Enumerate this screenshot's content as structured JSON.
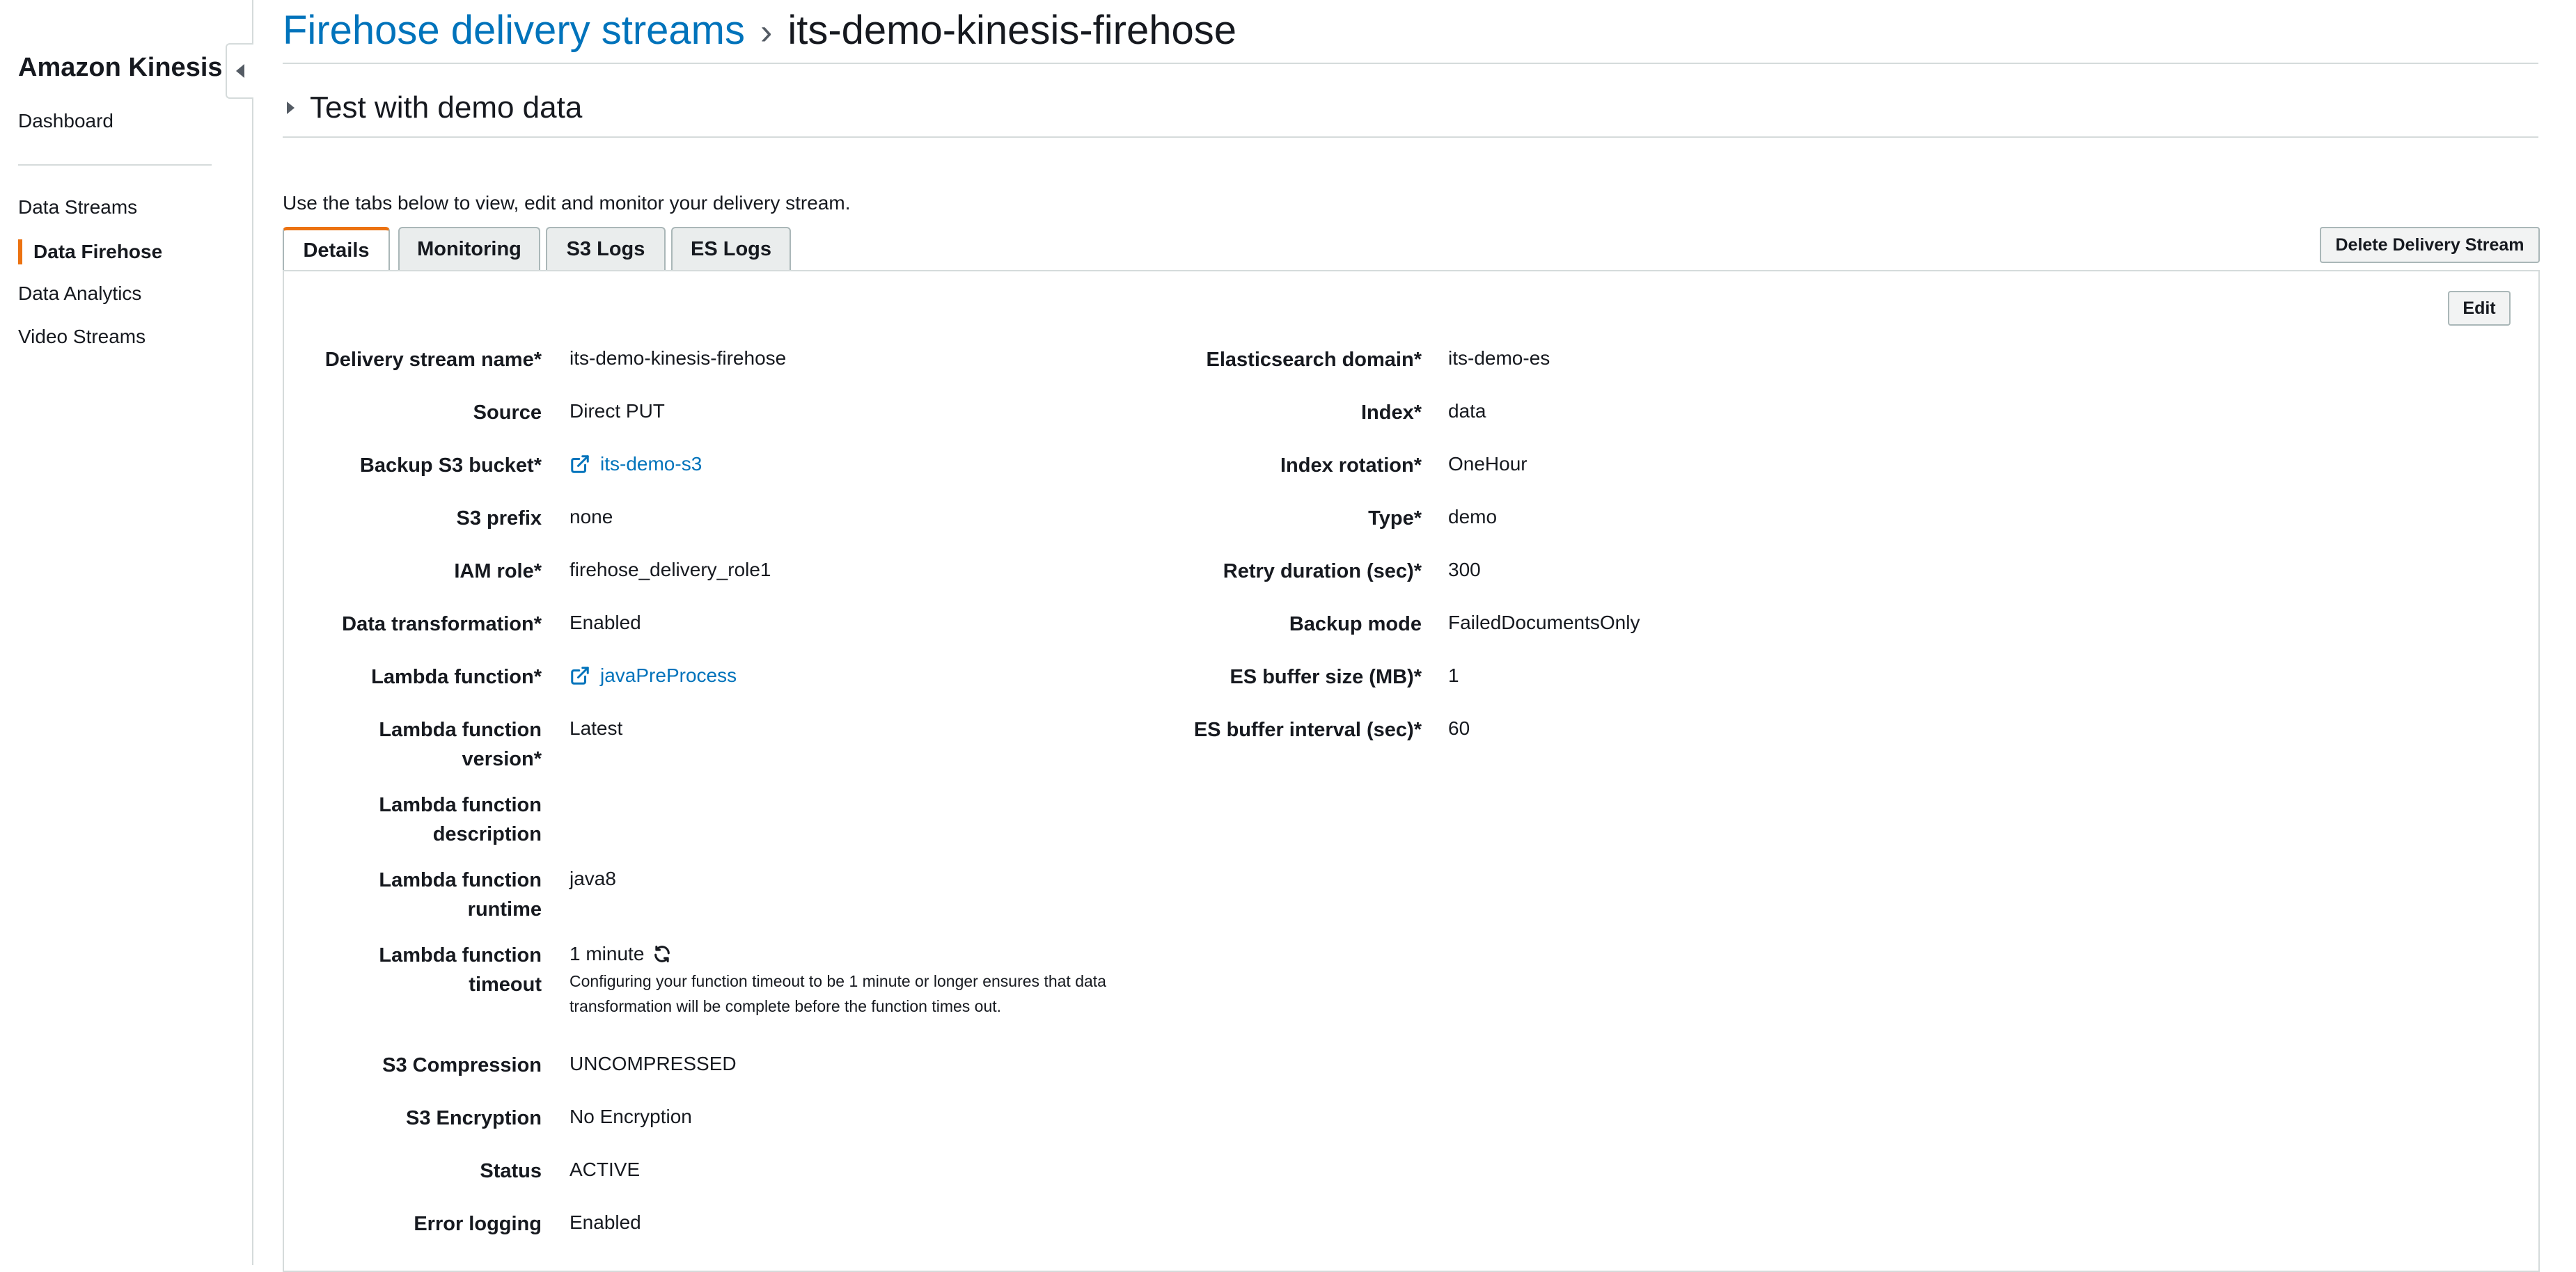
{
  "sidebar": {
    "brand": "Amazon Kinesis",
    "dashboard": "Dashboard",
    "items": [
      {
        "label": "Data Streams"
      },
      {
        "label": "Data Firehose",
        "active": true
      },
      {
        "label": "Data Analytics"
      },
      {
        "label": "Video Streams"
      }
    ]
  },
  "breadcrumb": {
    "parent": "Firehose delivery streams",
    "current": "its-demo-kinesis-firehose"
  },
  "test_section": "Test with demo data",
  "intro": "Use the tabs below to view, edit and monitor your delivery stream.",
  "tabs": [
    {
      "label": "Details",
      "active": true
    },
    {
      "label": "Monitoring"
    },
    {
      "label": "S3 Logs"
    },
    {
      "label": "ES Logs"
    }
  ],
  "actions": {
    "delete": "Delete Delivery Stream",
    "edit": "Edit"
  },
  "details_left": [
    {
      "label": "Delivery stream name*",
      "value": "its-demo-kinesis-firehose"
    },
    {
      "label": "Source",
      "value": "Direct PUT"
    },
    {
      "label": "Backup S3 bucket*",
      "value": "its-demo-s3"
    },
    {
      "label": "S3 prefix",
      "value": "none"
    },
    {
      "label": "IAM role*",
      "value": "firehose_delivery_role1"
    },
    {
      "label": "Data transformation*",
      "value": "Enabled"
    },
    {
      "label": "Lambda function*",
      "value": "javaPreProcess"
    },
    {
      "label_lines": [
        "Lambda function",
        "version*"
      ],
      "value": "Latest"
    },
    {
      "label_lines": [
        "Lambda function",
        "description"
      ],
      "value": ""
    },
    {
      "label_lines": [
        "Lambda function",
        "runtime"
      ],
      "value": "java8"
    },
    {
      "label_lines": [
        "Lambda function",
        "timeout"
      ],
      "value": "1 minute",
      "note_lines": [
        "Configuring your function timeout to be 1 minute or longer ensures that data",
        "transformation will be complete before the function times out."
      ]
    },
    {
      "label": "S3 Compression",
      "value": "UNCOMPRESSED"
    },
    {
      "label": "S3 Encryption",
      "value": "No Encryption"
    },
    {
      "label": "Status",
      "value": "ACTIVE"
    },
    {
      "label": "Error logging",
      "value": "Enabled"
    }
  ],
  "details_right": [
    {
      "label": "Elasticsearch domain*",
      "value": "its-demo-es"
    },
    {
      "label": "Index*",
      "value": "data"
    },
    {
      "label": "Index rotation*",
      "value": "OneHour"
    },
    {
      "label": "Type*",
      "value": "demo"
    },
    {
      "label": "Retry duration (sec)*",
      "value": "300"
    },
    {
      "label": "Backup mode",
      "value": "FailedDocumentsOnly"
    },
    {
      "label": "ES buffer size (MB)*",
      "value": "1"
    },
    {
      "label": "ES buffer interval (sec)*",
      "value": "60"
    }
  ],
  "colors": {
    "link": "#0073bb",
    "accent": "#ec7211",
    "border": "#d5dbdb"
  },
  "icons": [
    "external-link-icon",
    "refresh-icon",
    "caret-left-icon",
    "caret-right-icon"
  ]
}
